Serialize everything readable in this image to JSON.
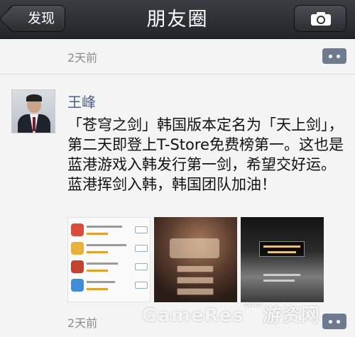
{
  "navbar": {
    "back_label": "发现",
    "title": "朋友圈",
    "camera_icon": "camera-icon"
  },
  "previous_post": {
    "time": "2天前"
  },
  "post": {
    "user_name": "王峰",
    "text": "「苍穹之剑」韩国版本定名为「天上剑」，第二天即登上T-Store免费榜第一。这也是蓝港游戏入韩发行第一剑，希望交好运。蓝港挥剑入韩，韩国团队加油！",
    "images": [
      "store-ranking-screenshot",
      "game-title-screen",
      "game-dialog-screen"
    ],
    "time": "2天前"
  },
  "watermark": {
    "text": "GameRes",
    "suffix": "com",
    "cn": "游资网"
  },
  "colors": {
    "navbar": "#2b2d31",
    "name": "#4a5f86",
    "comment_button": "#6e7b8f"
  }
}
